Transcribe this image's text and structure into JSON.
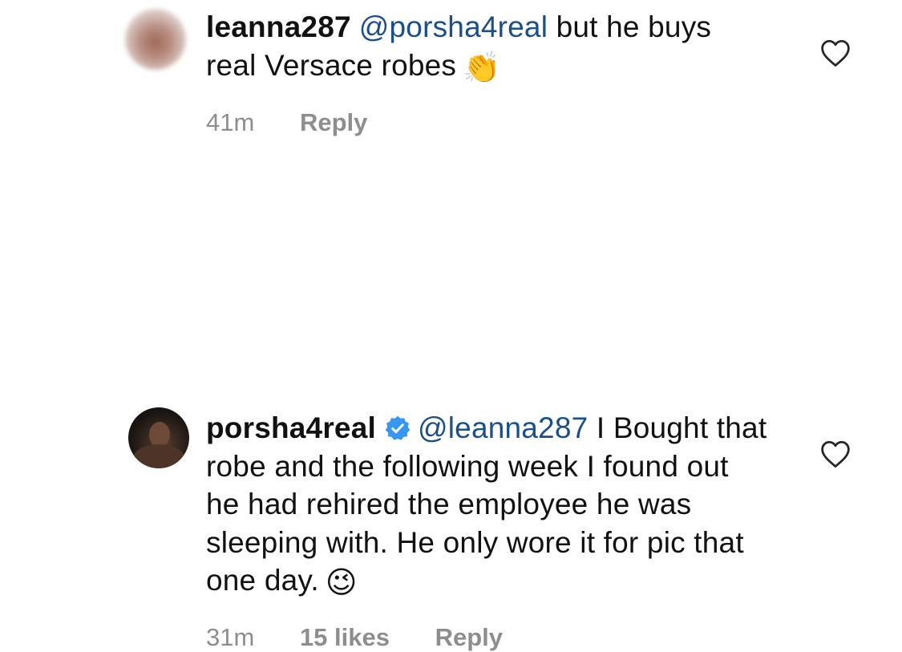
{
  "comments": [
    {
      "username": "leanna287",
      "mention": "@porsha4real",
      "text": "but he buys real Versace robes",
      "emoji": "👏",
      "time": "41m",
      "reply_label": "Reply",
      "avatar": "blurred-avatar"
    },
    {
      "username": "porsha4real",
      "verified": true,
      "mention": "@leanna287",
      "text": "I Bought that robe and the following week I found out he had rehired the employee he was sleeping with. He only wore it for pic that one day.",
      "emoji": "😉",
      "time": "31m",
      "likes": "15 likes",
      "reply_label": "Reply",
      "avatar": "profile-photo"
    }
  ],
  "icons": {
    "heart": "heart-outline-icon",
    "verified": "verified-badge-icon"
  },
  "colors": {
    "mention": "#1a4f8a",
    "meta": "#8e8e8e",
    "verified": "#3797f0"
  }
}
